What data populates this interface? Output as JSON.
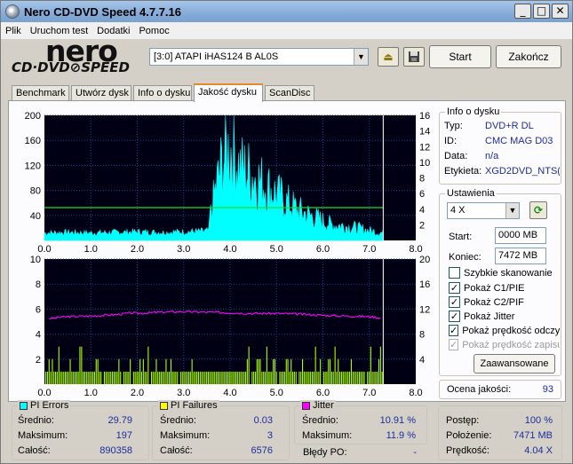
{
  "window": {
    "title": "Nero CD-DVD Speed 4.7.7.16",
    "min": "_",
    "max": "□",
    "close": "✕"
  },
  "menu": [
    "Plik",
    "Uruchom test",
    "Dodatki",
    "Pomoc"
  ],
  "logo": {
    "nero": "nero",
    "sub": "CD·DVD⊘SPEED"
  },
  "device": "[3:0]   ATAPI iHAS124   B AL0S",
  "buttons": {
    "start": "Start",
    "end": "Zakończ",
    "advanced": "Zaawansowane"
  },
  "tabs": [
    "Benchmark",
    "Utwórz dysk",
    "Info o dysku",
    "Jakość dysku",
    "ScanDisc"
  ],
  "active_tab": 3,
  "disc_info": {
    "title": "Info o dysku",
    "rows": [
      {
        "label": "Typ:",
        "value": "DVD+R DL"
      },
      {
        "label": "ID:",
        "value": "CMC MAG D03"
      },
      {
        "label": "Data:",
        "value": "n/a"
      },
      {
        "label": "Etykieta:",
        "value": "XGD2DVD_NTS("
      }
    ]
  },
  "settings": {
    "title": "Ustawienia",
    "speed": "4 X",
    "start_label": "Start:",
    "start_value": "0000 MB",
    "end_label": "Koniec:",
    "end_value": "7472 MB",
    "checks": [
      {
        "label": "Szybkie skanowanie",
        "checked": false,
        "disabled": false
      },
      {
        "label": "Pokaż C1/PIE",
        "checked": true,
        "disabled": false
      },
      {
        "label": "Pokaż C2/PIF",
        "checked": true,
        "disabled": false
      },
      {
        "label": "Pokaż Jitter",
        "checked": true,
        "disabled": false
      },
      {
        "label": "Pokaż prędkość odczytu",
        "checked": true,
        "disabled": false
      },
      {
        "label": "Pokaż prędkość zapisu",
        "checked": true,
        "disabled": true
      }
    ]
  },
  "quality": {
    "label": "Ocena jakości:",
    "value": "93"
  },
  "pi_errors": {
    "title": "PI Errors",
    "color": "#00ffff",
    "rows": [
      {
        "label": "Średnio:",
        "value": "29.79"
      },
      {
        "label": "Maksimum:",
        "value": "197"
      },
      {
        "label": "Całość:",
        "value": "890358"
      }
    ]
  },
  "pi_failures": {
    "title": "PI Failures",
    "color": "#ffff00",
    "rows": [
      {
        "label": "Średnio:",
        "value": "0.03"
      },
      {
        "label": "Maksimum:",
        "value": "3"
      },
      {
        "label": "Całość:",
        "value": "6576"
      }
    ]
  },
  "jitter": {
    "title": "Jitter",
    "color": "#ff00ff",
    "rows": [
      {
        "label": "Średnio:",
        "value": "10.91 %"
      },
      {
        "label": "Maksimum:",
        "value": "11.9 %"
      }
    ],
    "po_label": "Błędy PO:",
    "po_value": "-"
  },
  "progress": {
    "rows": [
      {
        "label": "Postęp:",
        "value": "100 %"
      },
      {
        "label": "Położenie:",
        "value": "7471 MB"
      },
      {
        "label": "Prędkość:",
        "value": "4.04 X"
      }
    ]
  },
  "chart_data": [
    {
      "type": "area",
      "x_ticks": [
        "0.0",
        "1.0",
        "2.0",
        "3.0",
        "4.0",
        "5.0",
        "6.0",
        "7.0",
        "8.0"
      ],
      "y_ticks_left": [
        "200",
        "160",
        "120",
        "80",
        "40"
      ],
      "y_ticks_right": [
        "16",
        "14",
        "12",
        "10",
        "8",
        "6",
        "4",
        "2"
      ],
      "xlim": [
        0,
        8
      ],
      "ylim_left": [
        0,
        200
      ],
      "ylim_right": [
        0,
        16
      ],
      "series": [
        {
          "color": "#00ffff",
          "x": [
            0,
            0.5,
            1.0,
            1.5,
            2.0,
            2.5,
            3.0,
            3.4,
            3.55,
            3.56,
            3.7,
            3.8,
            3.9,
            4.0,
            4.1,
            4.2,
            4.4,
            4.6,
            4.8,
            5.0,
            5.2,
            5.5,
            5.8,
            6.0,
            6.2,
            6.4,
            6.6,
            6.8,
            7.0,
            7.2
          ],
          "y": [
            14,
            15,
            14,
            15,
            16,
            15,
            16,
            17,
            18,
            45,
            110,
            150,
            175,
            190,
            170,
            150,
            140,
            125,
            110,
            95,
            80,
            60,
            48,
            40,
            32,
            30,
            28,
            24,
            20,
            16
          ]
        },
        {
          "color": "#22dd22",
          "x": [
            0,
            7.3
          ],
          "y": [
            4.2,
            4.2
          ]
        }
      ],
      "marker_x": 7.3
    },
    {
      "type": "bar",
      "x_ticks": [
        "0.0",
        "1.0",
        "2.0",
        "3.0",
        "4.0",
        "5.0",
        "6.0",
        "7.0",
        "8.0"
      ],
      "y_ticks_left": [
        "10",
        "8",
        "6",
        "4",
        "2"
      ],
      "y_ticks_right": [
        "20",
        "16",
        "12",
        "8",
        "4"
      ],
      "xlim": [
        0,
        8
      ],
      "ylim_left": [
        0,
        10
      ],
      "ylim_right": [
        0,
        20
      ],
      "series": [
        {
          "color": "#aaff00",
          "x": [
            0,
            7.3
          ],
          "y": [
            1,
            3
          ]
        },
        {
          "color": "#ff00ff",
          "x": [
            0.1,
            0.5,
            1.0,
            1.5,
            1.9,
            2.0,
            2.5,
            3.0,
            3.5,
            4.0,
            4.5,
            5.0,
            5.5,
            6.0,
            6.5,
            7.0,
            7.25
          ],
          "y": [
            10.5,
            10.8,
            10.9,
            11.1,
            11.4,
            11.3,
            11.5,
            11.6,
            11.5,
            11.4,
            11.3,
            11.3,
            11.2,
            11.0,
            10.9,
            10.8,
            10.6
          ]
        }
      ],
      "marker_x": 7.3
    }
  ]
}
